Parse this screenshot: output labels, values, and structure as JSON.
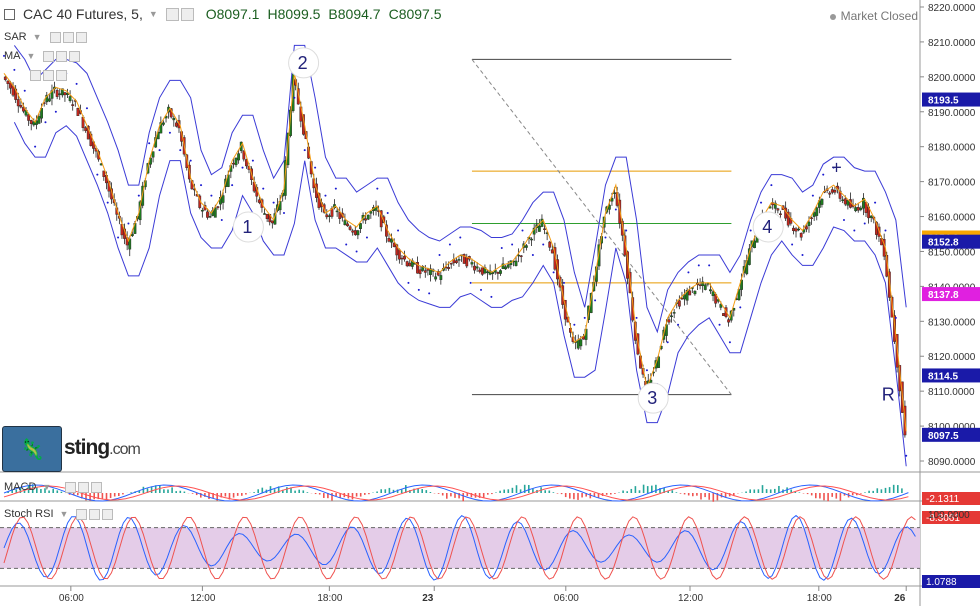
{
  "header": {
    "symbol": "CAC 40 Futures, 5,",
    "open": "O8097.1",
    "high": "H8099.5",
    "low": "B8094.7",
    "close": "C8097.5",
    "market_status": "Market Closed"
  },
  "indicators": {
    "sar_label": "SAR",
    "ma_label": "MA",
    "macd_label": "MACD",
    "stoch_label": "Stoch RSI"
  },
  "logo": {
    "text": "sting",
    "suffix": ".com"
  },
  "chart_data": {
    "type": "candlestick",
    "y_axis": {
      "ylim": [
        8088,
        8222
      ],
      "ticks": [
        8220,
        8210,
        8200,
        8190,
        8180,
        8170,
        8160,
        8150,
        8140,
        8130,
        8120,
        8110,
        8100,
        8090
      ]
    },
    "x_ticks": [
      "06:00",
      "12:00",
      "18:00",
      "23",
      "06:00",
      "12:00",
      "18:00",
      "26"
    ],
    "price_labels": [
      {
        "value": 8193.5,
        "text": "8193.5",
        "color": "#1a1aa8"
      },
      {
        "value": 8154.0,
        "text": "8154.0",
        "color": "#f7a600"
      },
      {
        "value": 8152.8,
        "text": "8152.8",
        "color": "#1a1aa8"
      },
      {
        "value": 8137.8,
        "text": "8137.8",
        "color": "#e020e0"
      },
      {
        "value": 8114.5,
        "text": "8114.5",
        "color": "#1a1aa8"
      },
      {
        "value": 8097.5,
        "text": "8097.5",
        "color": "#1a1aa8"
      }
    ],
    "horizontal_levels": [
      {
        "value": 8205,
        "color": "#444444"
      },
      {
        "value": 8173,
        "color": "#e69a00"
      },
      {
        "value": 8158,
        "color": "#2e9e2e"
      },
      {
        "value": 8141,
        "color": "#e69a00"
      },
      {
        "value": 8109,
        "color": "#444444"
      }
    ],
    "wave_labels": [
      {
        "text": "1",
        "x_frac": 0.27,
        "value": 8157
      },
      {
        "text": "2",
        "x_frac": 0.33,
        "value": 8204
      },
      {
        "text": "3",
        "x_frac": 0.71,
        "value": 8108
      },
      {
        "text": "4",
        "x_frac": 0.835,
        "value": 8157
      },
      {
        "text": "R",
        "x_frac": 0.965,
        "value": 8109
      },
      {
        "text": "+",
        "x_frac": 0.91,
        "value": 8174
      }
    ],
    "close_path": [
      8200,
      8196,
      8190,
      8186,
      8193,
      8196,
      8195,
      8192,
      8185,
      8178,
      8170,
      8160,
      8152,
      8160,
      8175,
      8185,
      8190,
      8185,
      8170,
      8163,
      8160,
      8165,
      8175,
      8180,
      8170,
      8162,
      8158,
      8167,
      8200,
      8185,
      8168,
      8160,
      8162,
      8158,
      8156,
      8160,
      8162,
      8155,
      8150,
      8147,
      8145,
      8144,
      8143,
      8146,
      8148,
      8147,
      8145,
      8143,
      8145,
      8146,
      8150,
      8155,
      8158,
      8150,
      8135,
      8123,
      8125,
      8142,
      8160,
      8168,
      8150,
      8125,
      8110,
      8118,
      8130,
      8135,
      8138,
      8140,
      8140,
      8135,
      8130,
      8140,
      8150,
      8158,
      8163,
      8162,
      8158,
      8155,
      8160,
      8166,
      8168,
      8165,
      8162,
      8164,
      8158,
      8150,
      8125,
      8097.5
    ],
    "macd": {
      "label_values": [
        "-2.1311",
        "-8.3061"
      ]
    },
    "stoch_rsi": {
      "label_values": [
        "100.0000",
        "1.0788"
      ],
      "band": [
        20,
        80
      ]
    }
  }
}
